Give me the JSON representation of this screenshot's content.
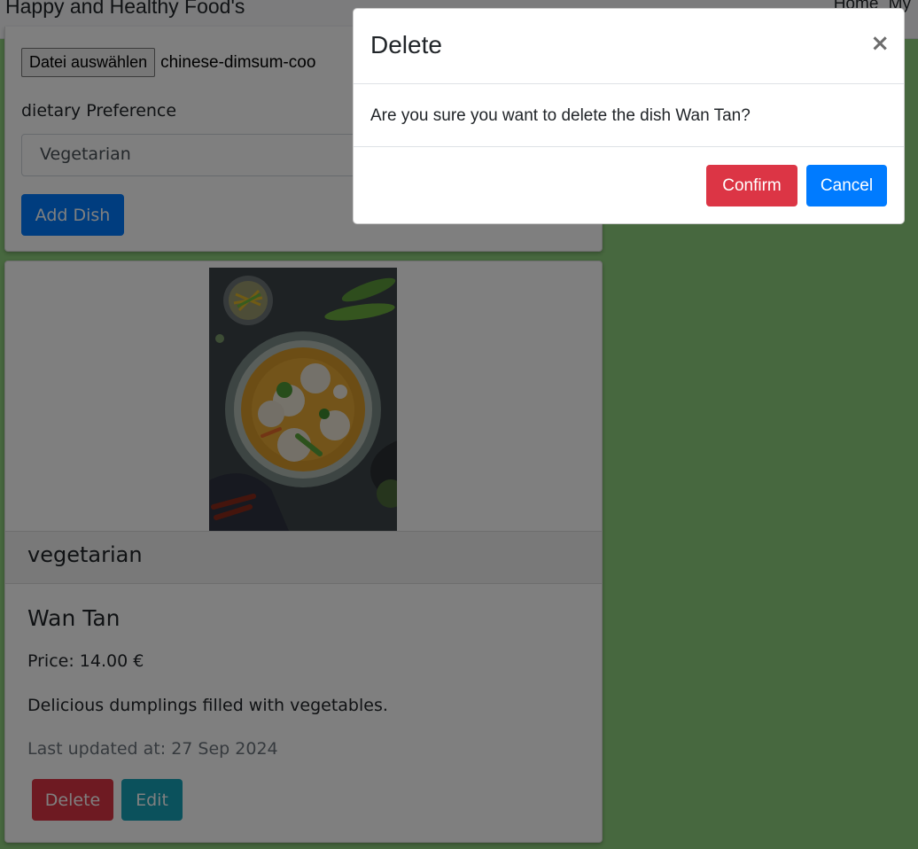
{
  "navbar": {
    "brand": "Happy and Healthy Food's",
    "links": [
      "Home",
      "My"
    ]
  },
  "form": {
    "file_button": "Datei auswählen",
    "file_name": "chinese-dimsum-coo",
    "preference_label": "dietary Preference",
    "preference_value": "Vegetarian",
    "add_button": "Add Dish"
  },
  "dish": {
    "category": "vegetarian",
    "title": "Wan Tan",
    "price": "Price: 14.00 €",
    "description": "Delicious dumplings filled with vegetables.",
    "updated": "Last updated at: 27 Sep 2024",
    "delete_label": "Delete",
    "edit_label": "Edit"
  },
  "modal": {
    "title": "Delete",
    "close_symbol": "×",
    "message": "Are you sure you want to delete the dish Wan Tan?",
    "confirm_label": "Confirm",
    "cancel_label": "Cancel"
  },
  "colors": {
    "page_background": "#8fd07e",
    "primary": "#007bff",
    "danger": "#dc3545",
    "info": "#17a2b8"
  }
}
